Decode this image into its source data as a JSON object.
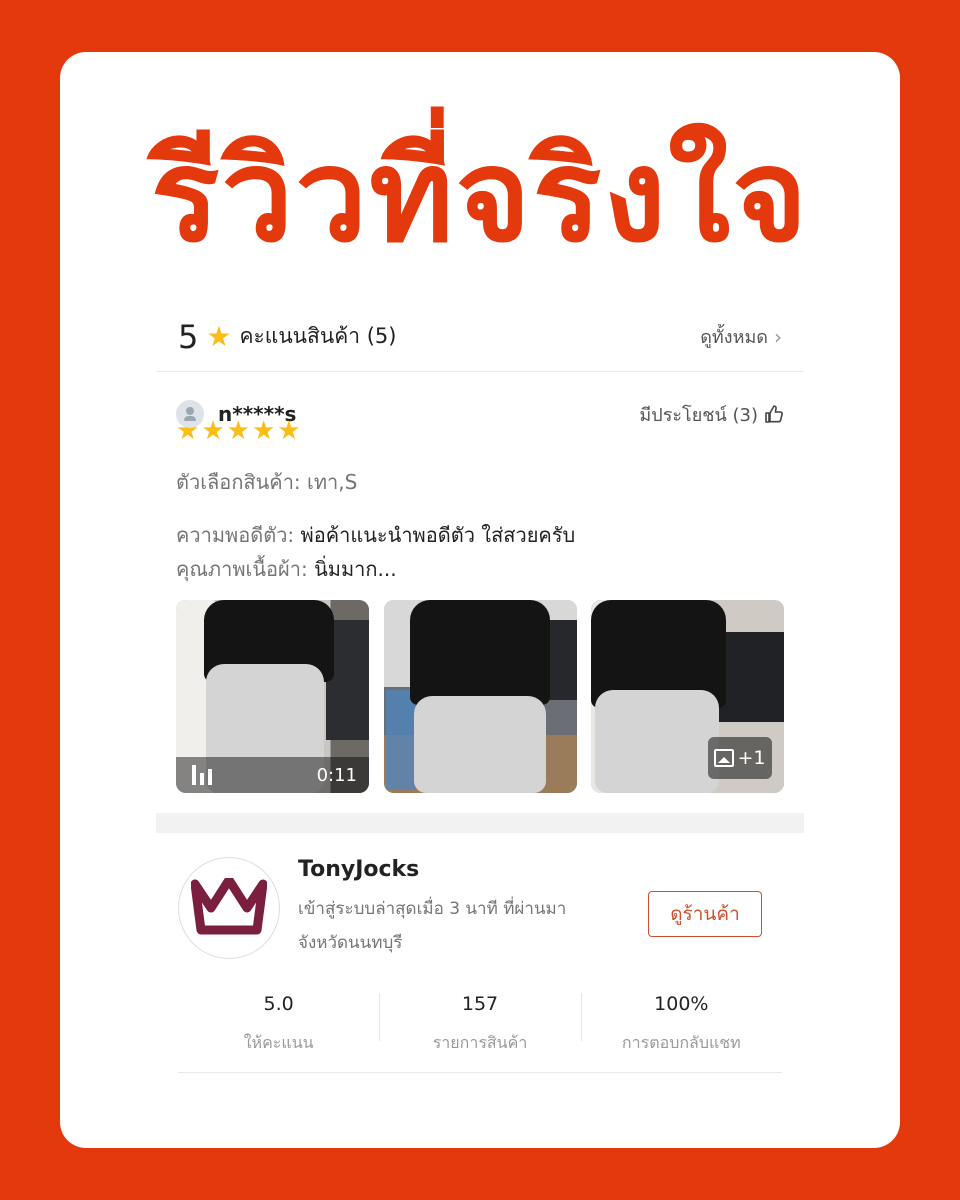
{
  "headline": "รีวิวที่จริงใจ",
  "rating_summary": {
    "score": "5",
    "label": "คะแนนสินค้า (5)",
    "see_all": "ดูทั้งหมด"
  },
  "review": {
    "reviewer": "n*****s",
    "helpful": "มีประโยชน์ (3)",
    "stars": 5,
    "variant_label": "ตัวเลือกสินค้า: เทา,S",
    "fit_label": "ความพอดีตัว:",
    "fit_value": "พ่อค้าแนะนำพอดีตัว ใส่สวยครับ",
    "fabric_label": "คุณภาพเนื้อผ้า:",
    "fabric_value": "นิ่มมาก...",
    "video_duration": "0:11",
    "more_images": "+1"
  },
  "shop": {
    "name": "TonyJocks",
    "last_active": "เข้าสู่ระบบล่าสุดเมื่อ 3 นาที ที่ผ่านมา",
    "location": "จังหวัดนนทบุรี",
    "view_button": "ดูร้านค้า",
    "stats": [
      {
        "value": "5.0",
        "label": "ให้คะแนน"
      },
      {
        "value": "157",
        "label": "รายการสินค้า"
      },
      {
        "value": "100%",
        "label": "การตอบกลับแชท"
      }
    ]
  },
  "colors": {
    "brand": "#e4380d",
    "star": "#fbbd18",
    "logo": "#7a1f3d"
  }
}
